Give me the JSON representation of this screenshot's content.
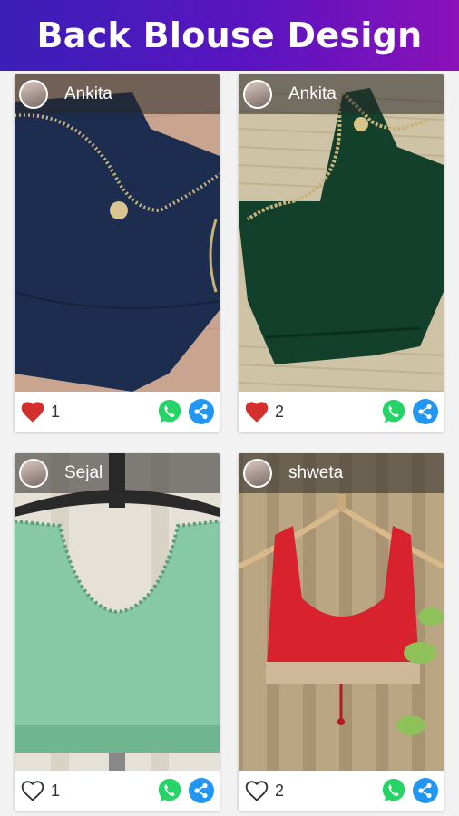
{
  "header": {
    "title": "Back Blouse Design"
  },
  "posts": [
    {
      "user": "Ankita",
      "likes": "1",
      "liked": true,
      "avatar_icon": "avatar-icon",
      "image_desc": "navy-blouse"
    },
    {
      "user": "Ankita",
      "likes": "2",
      "liked": true,
      "avatar_icon": "avatar-icon",
      "image_desc": "green-blouse"
    },
    {
      "user": "Sejal",
      "likes": "1",
      "liked": false,
      "avatar_icon": "avatar-icon",
      "image_desc": "mint-blouse"
    },
    {
      "user": "shweta",
      "likes": "2",
      "liked": false,
      "avatar_icon": "avatar-icon",
      "image_desc": "red-blouse"
    }
  ],
  "colors": {
    "heart_liked": "#d32f2f",
    "whatsapp": "#25d366",
    "share": "#2196f3",
    "header_start": "#3a1fb8",
    "header_end": "#8a12b8"
  }
}
